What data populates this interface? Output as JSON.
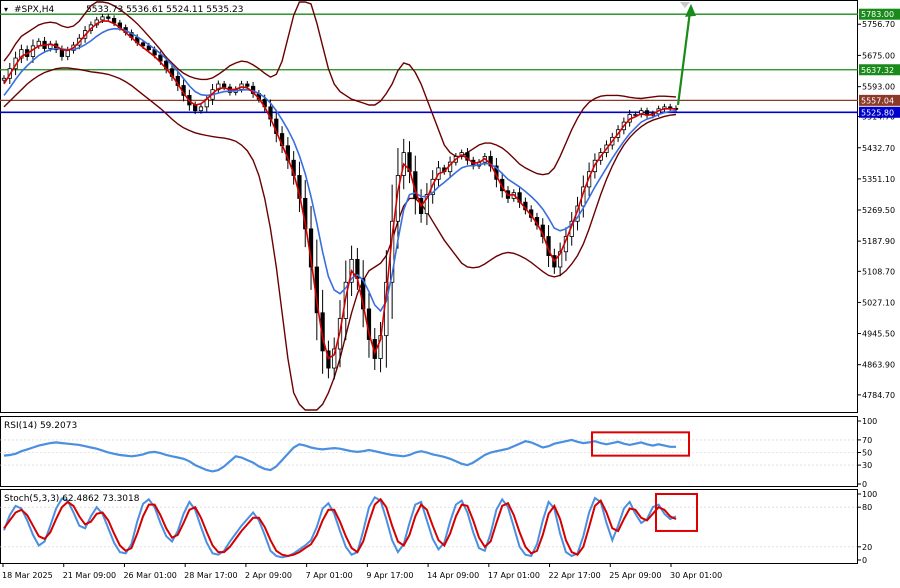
{
  "header": {
    "symbol": "#SPX,H4",
    "ohlc": "5533.73 5536.61 5524.11 5535.23"
  },
  "colors": {
    "candle": "#000000",
    "ma_fast": "#d40000",
    "ma_slow": "#3a6ee0",
    "bands": "#6b0000",
    "resistance": "#1a8a1a",
    "pivot": "#8b3a2a",
    "support": "#0000cc",
    "arrow": "#1a8a1a",
    "oscillator": "#4a8fe0",
    "stoch_signal": "#d40000",
    "highlight_box": "#e00000",
    "grid": "#000000"
  },
  "chart_data": [
    {
      "type": "line",
      "name": "price",
      "ylim": [
        4745,
        5815
      ],
      "y_ticks": [
        "5756.70",
        "5675.00",
        "5593.00",
        "5514.70",
        "5432.70",
        "5351.10",
        "5269.50",
        "5187.90",
        "5108.70",
        "5027.10",
        "4945.50",
        "4863.90",
        "4784.70"
      ],
      "x_ticks": [
        "18 Mar 2025",
        "21 Mar 09:00",
        "26 Mar 01:00",
        "28 Mar 17:00",
        "2 Apr 09:00",
        "7 Apr 01:00",
        "9 Apr 17:00",
        "14 Apr 09:00",
        "17 Apr 01:00",
        "22 Apr 17:00",
        "25 Apr 09:00",
        "30 Apr 01:00"
      ],
      "levels": [
        {
          "label": "5783.00",
          "value": 5783.0,
          "role": "resistance"
        },
        {
          "label": "5637.32",
          "value": 5637.32,
          "role": "resistance"
        },
        {
          "label": "5557.04",
          "value": 5557.04,
          "role": "pivot"
        },
        {
          "label": "5525.80",
          "value": 5525.8,
          "role": "support"
        }
      ],
      "close": [
        5615,
        5640,
        5668,
        5690,
        5672,
        5700,
        5712,
        5693,
        5705,
        5690,
        5672,
        5688,
        5702,
        5720,
        5740,
        5755,
        5768,
        5776,
        5772,
        5760,
        5748,
        5735,
        5722,
        5708,
        5700,
        5690,
        5676,
        5660,
        5640,
        5620,
        5596,
        5570,
        5545,
        5530,
        5540,
        5560,
        5585,
        5600,
        5592,
        5578,
        5586,
        5600,
        5594,
        5575,
        5560,
        5540,
        5508,
        5470,
        5438,
        5400,
        5360,
        5300,
        5220,
        5120,
        5000,
        4900,
        4855,
        4905,
        4985,
        5080,
        5140,
        5090,
        5010,
        4930,
        4880,
        4940,
        5080,
        5240,
        5360,
        5420,
        5370,
        5300,
        5260,
        5310,
        5350,
        5380,
        5370,
        5395,
        5410,
        5420,
        5400,
        5385,
        5395,
        5410,
        5385,
        5350,
        5320,
        5300,
        5315,
        5290,
        5270,
        5250,
        5230,
        5200,
        5150,
        5120,
        5160,
        5200,
        5240,
        5280,
        5330,
        5370,
        5400,
        5420,
        5440,
        5460,
        5480,
        5500,
        5520,
        5520,
        5530,
        5518,
        5522,
        5535,
        5540,
        5536,
        5535
      ],
      "ma_fast": [
        5600,
        5625,
        5650,
        5672,
        5680,
        5690,
        5700,
        5702,
        5704,
        5700,
        5690,
        5688,
        5695,
        5710,
        5728,
        5745,
        5758,
        5765,
        5765,
        5758,
        5748,
        5735,
        5722,
        5708,
        5696,
        5684,
        5672,
        5657,
        5640,
        5622,
        5600,
        5576,
        5555,
        5545,
        5548,
        5560,
        5575,
        5588,
        5590,
        5585,
        5586,
        5592,
        5590,
        5578,
        5562,
        5540,
        5510,
        5475,
        5440,
        5405,
        5365,
        5310,
        5235,
        5140,
        5030,
        4935,
        4880,
        4890,
        4950,
        5040,
        5110,
        5090,
        5020,
        4945,
        4895,
        4930,
        5050,
        5200,
        5320,
        5390,
        5375,
        5320,
        5280,
        5300,
        5335,
        5365,
        5370,
        5388,
        5403,
        5414,
        5405,
        5392,
        5394,
        5404,
        5390,
        5360,
        5330,
        5308,
        5310,
        5292,
        5274,
        5255,
        5234,
        5206,
        5165,
        5135,
        5155,
        5190,
        5228,
        5268,
        5315,
        5355,
        5388,
        5410,
        5430,
        5450,
        5470,
        5490,
        5508,
        5514,
        5522,
        5518,
        5520,
        5530,
        5535,
        5535,
        5535
      ],
      "ma_slow": [
        5570,
        5590,
        5612,
        5632,
        5648,
        5662,
        5675,
        5684,
        5690,
        5693,
        5692,
        5690,
        5690,
        5695,
        5703,
        5713,
        5725,
        5735,
        5742,
        5745,
        5744,
        5740,
        5733,
        5724,
        5714,
        5703,
        5692,
        5680,
        5666,
        5650,
        5633,
        5614,
        5595,
        5580,
        5572,
        5570,
        5572,
        5576,
        5580,
        5581,
        5582,
        5584,
        5585,
        5582,
        5575,
        5565,
        5550,
        5530,
        5506,
        5480,
        5450,
        5412,
        5365,
        5305,
        5235,
        5160,
        5095,
        5060,
        5050,
        5065,
        5090,
        5100,
        5085,
        5055,
        5020,
        5005,
        5030,
        5100,
        5190,
        5270,
        5310,
        5315,
        5305,
        5305,
        5315,
        5330,
        5342,
        5355,
        5368,
        5380,
        5385,
        5386,
        5388,
        5392,
        5390,
        5380,
        5365,
        5350,
        5340,
        5330,
        5318,
        5305,
        5290,
        5272,
        5248,
        5222,
        5215,
        5220,
        5232,
        5250,
        5275,
        5302,
        5330,
        5355,
        5380,
        5405,
        5428,
        5450,
        5470,
        5485,
        5500,
        5508,
        5513,
        5520,
        5525,
        5528,
        5530
      ],
      "band_upper": [
        5660,
        5680,
        5705,
        5725,
        5735,
        5745,
        5755,
        5760,
        5762,
        5760,
        5752,
        5748,
        5752,
        5765,
        5785,
        5805,
        5815,
        5815,
        5812,
        5805,
        5795,
        5784,
        5772,
        5758,
        5742,
        5725,
        5708,
        5690,
        5670,
        5655,
        5640,
        5628,
        5620,
        5615,
        5612,
        5612,
        5616,
        5625,
        5636,
        5648,
        5655,
        5660,
        5658,
        5650,
        5640,
        5628,
        5618,
        5625,
        5660,
        5720,
        5780,
        5815,
        5815,
        5810,
        5760,
        5700,
        5640,
        5600,
        5580,
        5570,
        5560,
        5555,
        5550,
        5545,
        5545,
        5555,
        5575,
        5600,
        5635,
        5655,
        5650,
        5630,
        5600,
        5560,
        5520,
        5480,
        5440,
        5420,
        5410,
        5410,
        5420,
        5430,
        5440,
        5445,
        5445,
        5440,
        5432,
        5420,
        5405,
        5390,
        5380,
        5372,
        5365,
        5362,
        5365,
        5380,
        5410,
        5445,
        5480,
        5510,
        5535,
        5552,
        5562,
        5568,
        5570,
        5570,
        5570,
        5568,
        5565,
        5563,
        5562,
        5564,
        5566,
        5568,
        5568,
        5567,
        5566
      ],
      "band_lower": [
        5540,
        5555,
        5570,
        5585,
        5600,
        5612,
        5622,
        5630,
        5635,
        5640,
        5642,
        5642,
        5640,
        5638,
        5635,
        5632,
        5630,
        5628,
        5625,
        5620,
        5614,
        5606,
        5596,
        5584,
        5572,
        5560,
        5548,
        5536,
        5522,
        5508,
        5495,
        5485,
        5478,
        5472,
        5468,
        5465,
        5462,
        5460,
        5458,
        5455,
        5450,
        5440,
        5425,
        5400,
        5360,
        5300,
        5220,
        5120,
        5000,
        4880,
        4790,
        4760,
        4745,
        4745,
        4745,
        4760,
        4790,
        4830,
        4880,
        4940,
        5000,
        5050,
        5085,
        5110,
        5120,
        5130,
        5150,
        5190,
        5240,
        5280,
        5300,
        5300,
        5285,
        5265,
        5240,
        5215,
        5190,
        5170,
        5150,
        5130,
        5120,
        5118,
        5120,
        5128,
        5138,
        5148,
        5155,
        5158,
        5156,
        5150,
        5142,
        5132,
        5120,
        5108,
        5098,
        5094,
        5098,
        5110,
        5128,
        5150,
        5180,
        5220,
        5265,
        5310,
        5350,
        5385,
        5415,
        5440,
        5460,
        5475,
        5488,
        5498,
        5505,
        5510,
        5515,
        5518,
        5520
      ],
      "annotations": [
        "up-arrow"
      ]
    },
    {
      "type": "line",
      "name": "RSI(14)",
      "label": "RSI(14) 59.2073",
      "ylim": [
        0,
        100
      ],
      "y_ticks": [
        "100",
        "70",
        "50",
        "30",
        "0"
      ],
      "values": [
        45,
        46,
        48,
        52,
        55,
        58,
        61,
        63,
        65,
        66,
        65,
        64,
        63,
        62,
        60,
        58,
        56,
        53,
        50,
        48,
        46,
        45,
        44,
        45,
        47,
        50,
        51,
        49,
        46,
        44,
        42,
        40,
        36,
        30,
        26,
        22,
        20,
        22,
        28,
        36,
        44,
        42,
        38,
        34,
        28,
        24,
        22,
        28,
        38,
        48,
        58,
        63,
        61,
        58,
        56,
        55,
        56,
        57,
        56,
        54,
        52,
        51,
        52,
        54,
        52,
        50,
        48,
        46,
        45,
        44,
        46,
        50,
        52,
        50,
        47,
        45,
        43,
        40,
        36,
        32,
        30,
        34,
        40,
        46,
        50,
        52,
        54,
        56,
        60,
        64,
        68,
        66,
        62,
        58,
        60,
        64,
        66,
        68,
        70,
        67,
        65,
        66,
        68,
        65,
        63,
        65,
        67,
        64,
        62,
        64,
        66,
        63,
        61,
        63,
        61,
        59,
        59
      ]
    },
    {
      "type": "line",
      "name": "Stoch(5,3,3)",
      "label": "Stoch(5,3,3) 62.4862 73.3018",
      "ylim": [
        0,
        100
      ],
      "y_ticks": [
        "100",
        "80",
        "20",
        "0"
      ],
      "k": [
        45,
        68,
        82,
        78,
        60,
        38,
        22,
        28,
        52,
        78,
        93,
        90,
        72,
        52,
        48,
        66,
        80,
        70,
        48,
        26,
        12,
        10,
        24,
        58,
        85,
        92,
        80,
        56,
        36,
        28,
        44,
        70,
        88,
        76,
        50,
        26,
        10,
        8,
        14,
        28,
        40,
        52,
        62,
        72,
        60,
        38,
        14,
        6,
        4,
        6,
        10,
        16,
        22,
        30,
        50,
        78,
        86,
        70,
        44,
        20,
        8,
        12,
        44,
        80,
        95,
        90,
        62,
        30,
        12,
        24,
        56,
        84,
        88,
        60,
        32,
        16,
        26,
        58,
        84,
        90,
        72,
        42,
        18,
        14,
        40,
        76,
        92,
        80,
        50,
        20,
        8,
        6,
        24,
        60,
        88,
        78,
        40,
        12,
        6,
        10,
        36,
        72,
        94,
        88,
        56,
        30,
        52,
        78,
        88,
        70,
        56,
        62,
        80,
        84,
        70,
        62,
        66
      ],
      "d": [
        48,
        60,
        72,
        76,
        68,
        52,
        36,
        32,
        42,
        62,
        80,
        88,
        82,
        66,
        54,
        58,
        70,
        72,
        60,
        40,
        22,
        14,
        18,
        40,
        66,
        84,
        84,
        68,
        48,
        34,
        38,
        56,
        76,
        80,
        64,
        42,
        22,
        12,
        12,
        20,
        32,
        44,
        54,
        64,
        64,
        50,
        30,
        14,
        8,
        6,
        8,
        12,
        18,
        24,
        38,
        60,
        76,
        76,
        58,
        36,
        18,
        12,
        28,
        58,
        84,
        92,
        80,
        52,
        28,
        22,
        38,
        66,
        84,
        76,
        52,
        30,
        22,
        40,
        66,
        84,
        82,
        60,
        34,
        20,
        28,
        56,
        82,
        86,
        68,
        42,
        20,
        10,
        14,
        38,
        70,
        82,
        62,
        30,
        12,
        8,
        20,
        50,
        82,
        90,
        72,
        48,
        44,
        62,
        78,
        76,
        64,
        60,
        70,
        80,
        76,
        66,
        62
      ]
    }
  ]
}
